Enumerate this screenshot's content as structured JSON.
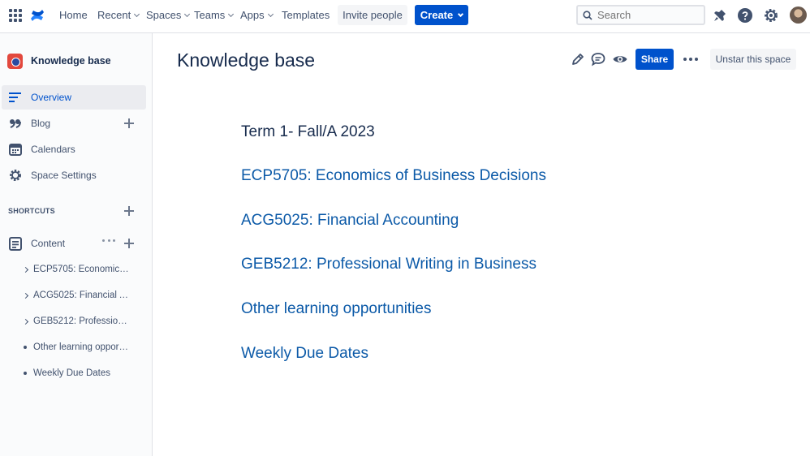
{
  "topnav": {
    "items": [
      {
        "label": "Home",
        "dropdown": false
      },
      {
        "label": "Recent",
        "dropdown": true
      },
      {
        "label": "Spaces",
        "dropdown": true
      },
      {
        "label": "Teams",
        "dropdown": true
      },
      {
        "label": "Apps",
        "dropdown": true
      },
      {
        "label": "Templates",
        "dropdown": false
      }
    ],
    "invite_label": "Invite people",
    "create_label": "Create",
    "search_placeholder": "Search"
  },
  "sidebar": {
    "space_name": "Knowledge base",
    "items": [
      {
        "label": "Overview",
        "icon": "overview-icon",
        "active": true
      },
      {
        "label": "Blog",
        "icon": "quote-icon"
      },
      {
        "label": "Calendars",
        "icon": "calendar-icon"
      },
      {
        "label": "Space Settings",
        "icon": "gear-icon"
      }
    ],
    "shortcuts_label": "SHORTCUTS",
    "content_label": "Content",
    "tree": [
      {
        "label": "ECP5705: Economics of Business Decisions",
        "type": "expand"
      },
      {
        "label": "ACG5025: Financial Accounting",
        "type": "expand"
      },
      {
        "label": "GEB5212: Professional Writing in Business",
        "type": "expand"
      },
      {
        "label": "Other learning opportunities",
        "type": "bullet"
      },
      {
        "label": "Weekly Due Dates",
        "type": "bullet"
      }
    ]
  },
  "page": {
    "title": "Knowledge base",
    "share_label": "Share",
    "unstar_label": "Unstar this space",
    "term": "Term 1- Fall/A 2023",
    "courses": [
      "ECP5705: Economics of Business Decisions",
      "ACG5025: Financial Accounting",
      "GEB5212: Professional Writing in Business",
      "Other learning opportunities",
      "Weekly Due Dates"
    ]
  },
  "colors": {
    "brand_blue": "#0052cc",
    "link_blue": "#0c5aa8",
    "text": "#172b4d"
  }
}
